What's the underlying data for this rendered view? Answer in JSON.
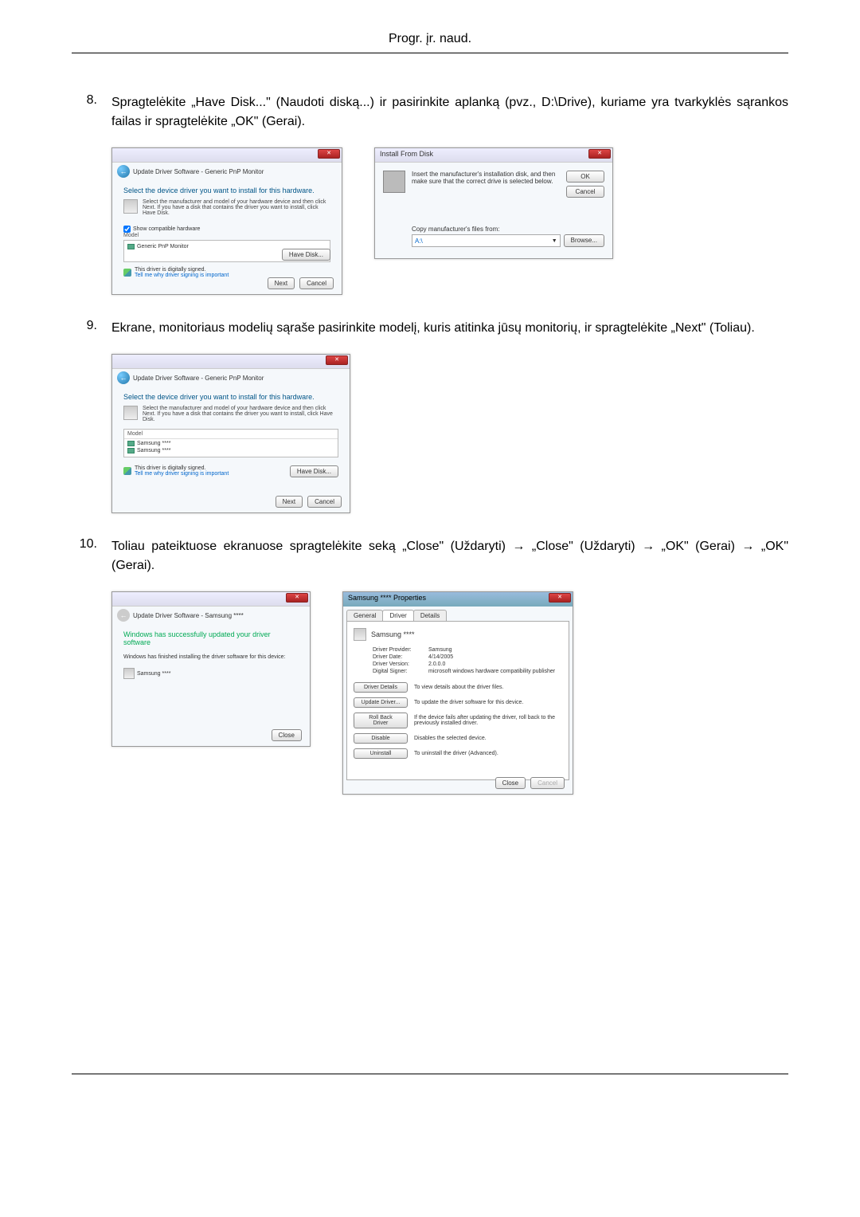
{
  "page": {
    "header": "Progr. įr. naud."
  },
  "steps": {
    "s8": {
      "num": "8.",
      "text": "Spragtelėkite „Have Disk...\" (Naudoti diską...) ir pasirinkite aplanką (pvz., D:\\Drive), kuriame yra tvarkyklės sąrankos failas ir spragtelėkite „OK\" (Gerai)."
    },
    "s9": {
      "num": "9.",
      "text": "Ekrane, monitoriaus modelių sąraše pasirinkite modelį, kuris atitinka jūsų monitorių, ir spragtelėkite „Next\" (Toliau)."
    },
    "s10": {
      "num": "10.",
      "text": "Toliau pateiktuose ekranuose spragtelėkite seką „Close\" (Uždaryti) → „Close\" (Uždaryti) → „OK\" (Gerai) → „OK\" (Gerai)."
    }
  },
  "dlgA": {
    "nav_title": "Update Driver Software - Generic PnP Monitor",
    "heading": "Select the device driver you want to install for this hardware.",
    "subtext": "Select the manufacturer and model of your hardware device and then click Next. If you have a disk that contains the driver you want to install, click Have Disk.",
    "checkbox": "Show compatible hardware",
    "list_header": "Model",
    "list_item": "Generic PnP Monitor",
    "signed": "This driver is digitally signed.",
    "link": "Tell me why driver signing is important",
    "have_disk": "Have Disk...",
    "next": "Next",
    "cancel": "Cancel"
  },
  "dlgB": {
    "title": "Install From Disk",
    "text": "Insert the manufacturer's installation disk, and then make sure that the correct drive is selected below.",
    "ok": "OK",
    "cancel": "Cancel",
    "copy_label": "Copy manufacturer's files from:",
    "path": "A:\\",
    "browse": "Browse..."
  },
  "dlgC": {
    "nav_title": "Update Driver Software - Generic PnP Monitor",
    "heading": "Select the device driver you want to install for this hardware.",
    "subtext": "Select the manufacturer and model of your hardware device and then click Next. If you have a disk that contains the driver you want to install, click Have Disk.",
    "list_header": "Model",
    "item1": "Samsung ****",
    "item2": "Samsung ****",
    "signed": "This driver is digitally signed.",
    "link": "Tell me why driver signing is important",
    "have_disk": "Have Disk...",
    "next": "Next",
    "cancel": "Cancel"
  },
  "dlgD": {
    "nav_title": "Update Driver Software - Samsung ****",
    "heading": "Windows has successfully updated your driver software",
    "subtext": "Windows has finished installing the driver software for this device:",
    "device": "Samsung ****",
    "close": "Close"
  },
  "dlgE": {
    "title": "Samsung **** Properties",
    "tab1": "General",
    "tab2": "Driver",
    "tab3": "Details",
    "device": "Samsung ****",
    "provider_l": "Driver Provider:",
    "provider_v": "Samsung",
    "date_l": "Driver Date:",
    "date_v": "4/14/2005",
    "ver_l": "Driver Version:",
    "ver_v": "2.0.0.0",
    "signer_l": "Digital Signer:",
    "signer_v": "microsoft windows hardware compatibility publisher",
    "btn_details": "Driver Details",
    "desc_details": "To view details about the driver files.",
    "btn_update": "Update Driver...",
    "desc_update": "To update the driver software for this device.",
    "btn_rollback": "Roll Back Driver",
    "desc_rollback": "If the device fails after updating the driver, roll back to the previously installed driver.",
    "btn_disable": "Disable",
    "desc_disable": "Disables the selected device.",
    "btn_uninstall": "Uninstall",
    "desc_uninstall": "To uninstall the driver (Advanced).",
    "close": "Close",
    "cancel": "Cancel"
  }
}
